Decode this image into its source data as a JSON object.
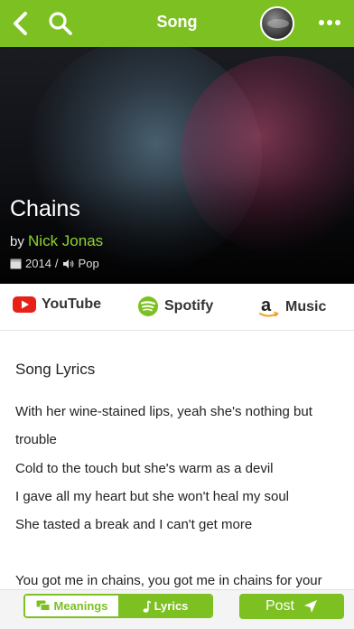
{
  "header": {
    "title": "Song",
    "back_icon": "chevron-left-icon",
    "search_icon": "search-icon",
    "more_icon": "more-dots-icon",
    "accent": "#7cc121"
  },
  "hero": {
    "song_title": "Chains",
    "by_label": "by",
    "artist": "Nick Jonas",
    "year": "2014",
    "separator": "/",
    "genre": "Pop",
    "artist_color": "#8ed52c"
  },
  "services": [
    {
      "label": "YouTube",
      "icon": "youtube-icon",
      "color": "#e62117"
    },
    {
      "label": "Spotify",
      "icon": "spotify-icon",
      "color": "#7cc121"
    },
    {
      "label": "Music",
      "icon": "amazon-icon",
      "color": "#222222"
    }
  ],
  "lyrics": {
    "heading": "Song Lyrics",
    "lines": [
      "With her wine-stained lips, yeah she's nothing but",
      "trouble",
      "Cold to the touch but she's warm as a devil",
      "I gave all my heart but she won't heal my soul",
      "She tasted a break and I can't get more",
      "",
      "You got me in chains, you got me in chains for your"
    ]
  },
  "bottom": {
    "meanings_label": "Meanings",
    "lyrics_label": "Lyrics",
    "post_label": "Post"
  }
}
